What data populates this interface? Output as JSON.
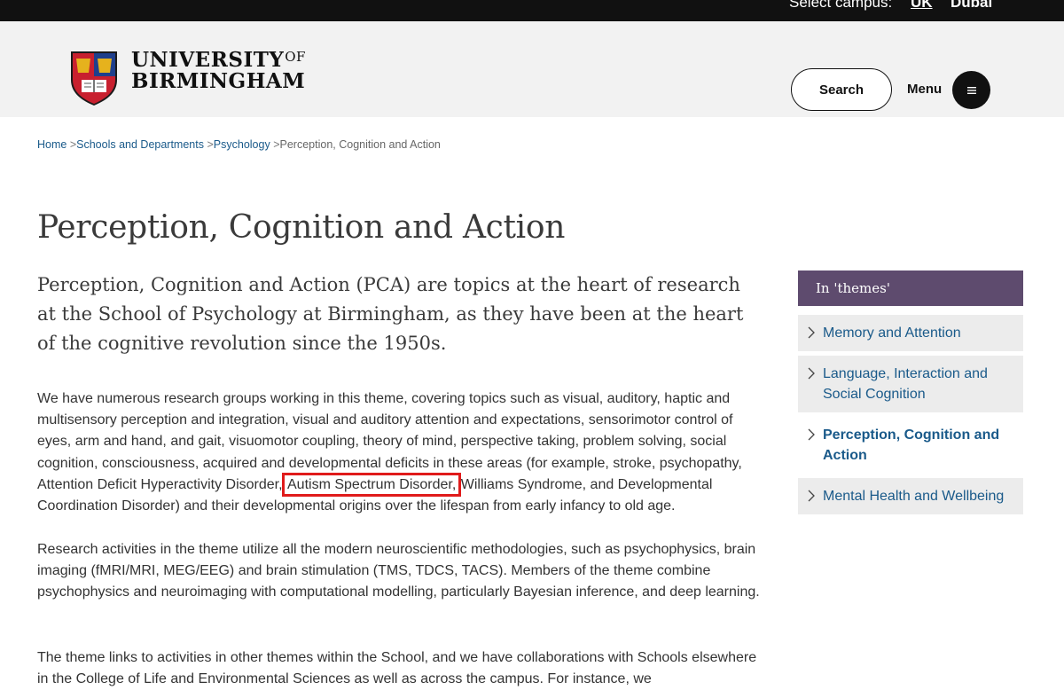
{
  "topbar": {
    "campus_label": "Select campus:",
    "campus_uk": "UK",
    "campus_dubai": "Dubai"
  },
  "header": {
    "logo_line1": "UNIVERSITY",
    "logo_of": "OF",
    "logo_line2": "BIRMINGHAM",
    "search_label": "Search",
    "menu_label": "Menu"
  },
  "breadcrumb": {
    "items": [
      "Home",
      "Schools and Departments",
      "Psychology"
    ],
    "separator": ">",
    "current": "Perception, Cognition and Action"
  },
  "main": {
    "title": "Perception, Cognition and Action",
    "intro": "Perception, Cognition and Action (PCA) are topics at the heart of research at the School of Psychology at Birmingham, as they have been at the heart of the cognitive revolution since the 1950s.",
    "p1_before": "We have numerous research groups working in this theme, covering topics such as visual, auditory, haptic and multisensory perception and integration, visual and auditory attention and expectations, sensorimotor control of eyes, arm and hand, and gait, visuomotor coupling, theory of mind, perspective taking, problem solving, social cognition, consciousness, acquired and developmental deficits in these areas (for example, stroke, psychopathy, Attention Deficit Hyperactivity Disorder,",
    "p1_highlight": "Autism Spectrum Disorder,",
    "p1_after": "Williams Syndrome, and Developmental Coordination Disorder) and their developmental origins over the lifespan from early infancy to old age.",
    "p2": "Research activities in the theme utilize all the modern neuroscientific methodologies, such as psychophysics, brain imaging (fMRI/MRI, MEG/EEG) and brain stimulation (TMS, TDCS, TACS). Members of the theme combine psychophysics and neuroimaging with computational modelling, particularly Bayesian inference, and deep learning.",
    "p3": "The theme links to activities in other themes within the School, and we have collaborations with Schools elsewhere in the College of Life and Environmental Sciences as well as across the campus. For instance, we"
  },
  "sidebar": {
    "heading": "In 'themes'",
    "items": [
      {
        "label": "Memory and Attention"
      },
      {
        "label": "Language, Interaction and Social Cognition"
      },
      {
        "label": "Perception, Cognition and Action"
      },
      {
        "label": "Mental Health and Wellbeing"
      }
    ]
  },
  "colors": {
    "topbar": "#111111",
    "header_bg": "#f2f2f2",
    "sidebar_heading": "#5e4b6e",
    "link": "#1a5a8a",
    "highlight_box": "#e01b1b"
  }
}
